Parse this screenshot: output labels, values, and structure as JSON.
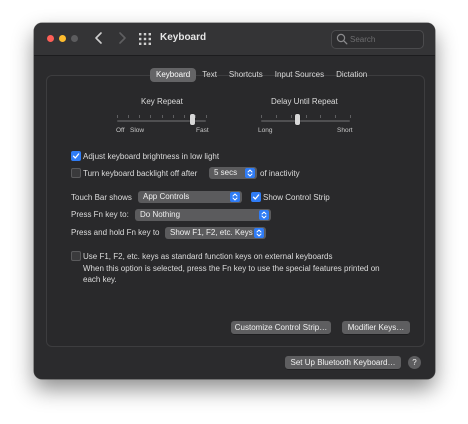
{
  "window": {
    "title": "Keyboard"
  },
  "search": {
    "placeholder": "Search"
  },
  "tabs": [
    {
      "label": "Keyboard",
      "active": true
    },
    {
      "label": "Text",
      "active": false
    },
    {
      "label": "Shortcuts",
      "active": false
    },
    {
      "label": "Input Sources",
      "active": false
    },
    {
      "label": "Dictation",
      "active": false
    }
  ],
  "key_repeat": {
    "label": "Key Repeat",
    "min_labels": [
      "Off",
      "Slow"
    ],
    "max_label": "Fast",
    "value": 0.85
  },
  "delay_until_repeat": {
    "label": "Delay Until Repeat",
    "min_label": "Long",
    "max_label": "Short",
    "value": 0.41
  },
  "options": {
    "brightness": {
      "label": "Adjust keyboard brightness in low light",
      "checked": true
    },
    "backlight_off": {
      "label": "Turn keyboard backlight off after",
      "checked": false,
      "value": "5 secs",
      "suffix": "of inactivity"
    }
  },
  "touch_bar": {
    "label": "Touch Bar shows",
    "value": "App Controls",
    "control_strip": {
      "label": "Show Control Strip",
      "checked": true
    }
  },
  "fn_key": {
    "label": "Press Fn key to:",
    "value": "Do Nothing"
  },
  "fn_hold": {
    "label": "Press and hold Fn key to",
    "value": "Show F1, F2, etc. Keys"
  },
  "function_keys": {
    "label": "Use F1, F2, etc. keys as standard function keys on external keyboards",
    "checked": false,
    "note": "When this option is selected, press the Fn key to use the special features printed on each key."
  },
  "buttons": {
    "customize": "Customize Control Strip…",
    "modifier": "Modifier Keys…",
    "bluetooth": "Set Up Bluetooth Keyboard…",
    "help": "?"
  },
  "colors": {
    "accent": "#2f7cf6",
    "window_bg": "#2b2b2d"
  }
}
